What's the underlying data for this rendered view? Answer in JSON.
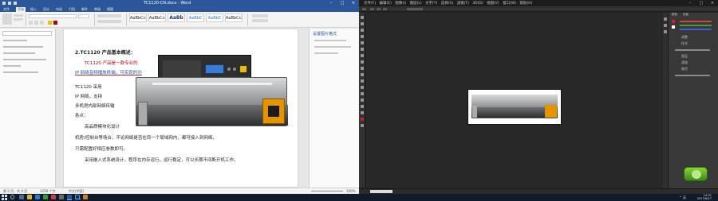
{
  "word": {
    "window_title": "TC1120-CN.docx - Word",
    "tabs": [
      "文件",
      "开始",
      "插入",
      "设计",
      "布局",
      "引用",
      "邮件",
      "审阅",
      "视图"
    ],
    "active_tab": "开始",
    "styles": [
      "AaBbCcDd",
      "AaBbCcDd",
      "AaBb",
      "AaBbC",
      "AaBbC",
      "AaBbCcD"
    ],
    "right_pane_title": "设置图片格式",
    "doc_lines": [
      "2.TC1120 产品基本概述：",
      "TC1120 产品是一款专业的 ",
      "IP 网络音频播放终端，可实现的功",
      "TC1120 采用 ",
      "IP 网络，支持",
      "多机房内部网络传输",
      "各点：",
      "高品质模块化设计",
      "机房/控制台等场合，不论网络是否在同一个局域网内，都可接入到网络，",
      "只需配置好相应参数即可。",
      "采用嵌入式系统设计，程序在内存运行，运行稳定，可以长期不间断开机工作。"
    ],
    "status": {
      "page": "第 2 页，共 4 页",
      "words": "1256 个字",
      "lang": "中文(中国)",
      "zoom": "100%"
    }
  },
  "photoshop": {
    "menu": [
      "文件(F)",
      "编辑(E)",
      "图像(I)",
      "图层(L)",
      "文字(Y)",
      "选择(S)",
      "滤镜(T)",
      "3D(D)",
      "视图(V)",
      "窗口(W)",
      "帮助(H)"
    ],
    "panel_tabs": [
      "颜色",
      "色板"
    ],
    "panel_text": [
      "调整",
      "样式",
      "图层",
      "通道",
      "路径"
    ],
    "swatch_colors": [
      "#ff0000",
      "#ffff00",
      "#00ff00",
      "#00ffff",
      "#0000ff",
      "#ff00ff",
      "#ffffff",
      "#000000"
    ]
  },
  "taskbar": {
    "time": "14:31",
    "date": "2017/8/17",
    "tray": "^ 英"
  },
  "colors": {
    "word_blue": "#2b579a",
    "ps_dark": "#262626",
    "taskbar": "#101a2b"
  }
}
